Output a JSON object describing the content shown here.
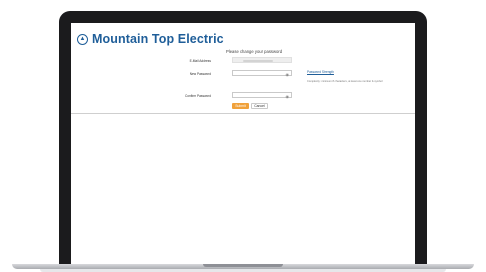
{
  "brand": {
    "name": "Mountain Top Electric",
    "icon": "mountain-logo-icon",
    "color": "#1f5e99"
  },
  "form": {
    "heading": "Please change your password",
    "email_label": "E-Mail Address",
    "new_password_label": "New Password",
    "confirm_password_label": "Confirm Password",
    "password_strength_link": "Password Strength",
    "password_help": "Complexity: minimum 8 characters, at least one number & symbol",
    "submit_label": "Submit",
    "cancel_label": "Cancel",
    "submit_color": "#f0a13a",
    "eye_icon": "eye-icon"
  }
}
